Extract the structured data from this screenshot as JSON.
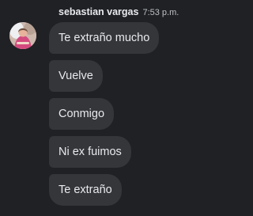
{
  "message_group": {
    "sender": "sebastian vargas",
    "time": "7:53 p.m.",
    "avatar_icon": "user-photo-avatar",
    "messages": [
      "Te extraño mucho",
      "Vuelve",
      "Conmigo",
      "Ni ex fuimos",
      "Te extraño"
    ]
  },
  "colors": {
    "background": "#202124",
    "bubble": "#35363a",
    "text": "#e8eaed",
    "secondary_text": "#bdc1c6"
  }
}
